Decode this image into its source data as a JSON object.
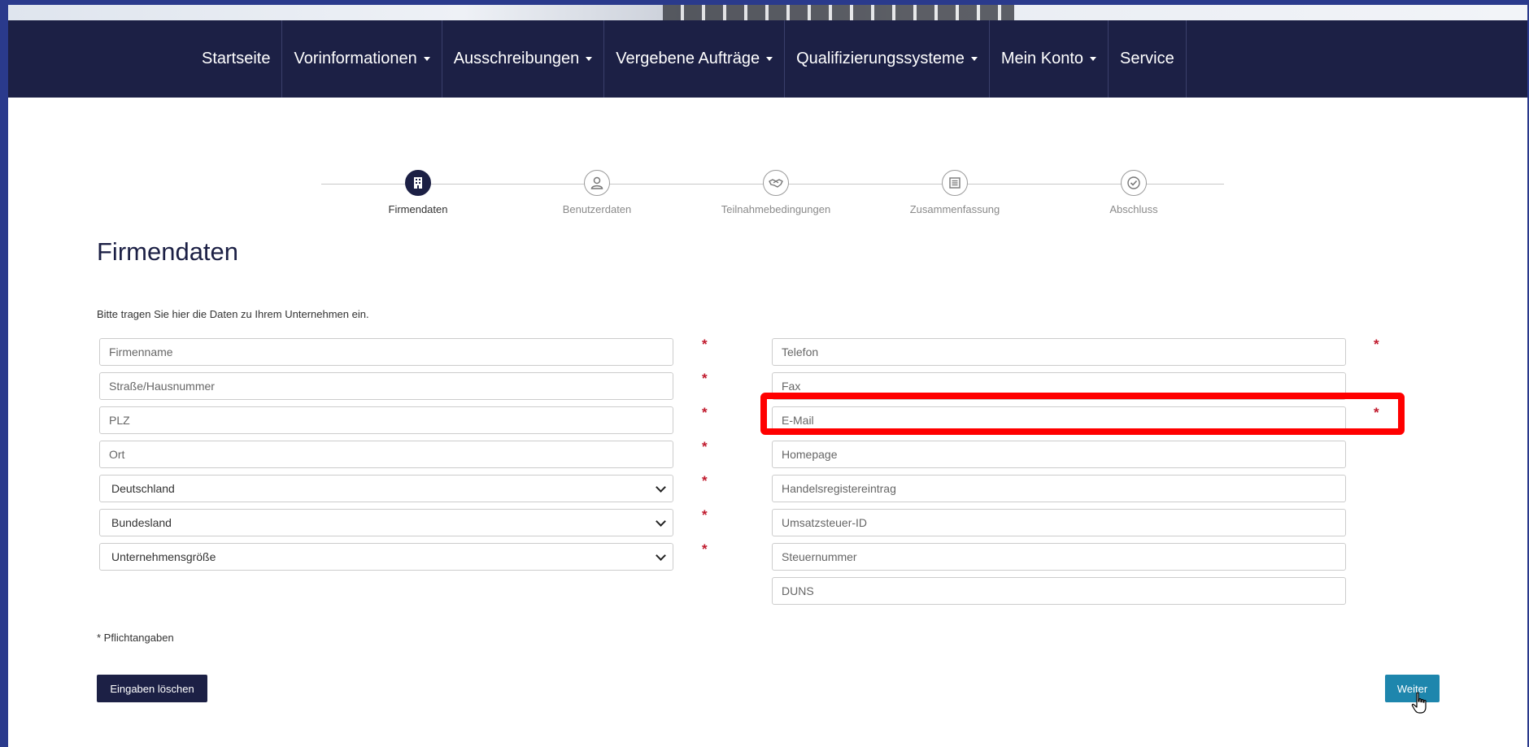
{
  "nav": {
    "items": [
      {
        "label": "Startseite",
        "dropdown": false
      },
      {
        "label": "Vorinformationen",
        "dropdown": true
      },
      {
        "label": "Ausschreibungen",
        "dropdown": true
      },
      {
        "label": "Vergebene Aufträge",
        "dropdown": true
      },
      {
        "label": "Qualifizierungssysteme",
        "dropdown": true
      },
      {
        "label": "Mein Konto",
        "dropdown": true
      },
      {
        "label": "Service",
        "dropdown": false
      }
    ]
  },
  "stepper": {
    "steps": [
      {
        "label": "Firmendaten",
        "icon": "building-icon",
        "active": true
      },
      {
        "label": "Benutzerdaten",
        "icon": "user-icon",
        "active": false
      },
      {
        "label": "Teilnahmebedingungen",
        "icon": "handshake-icon",
        "active": false
      },
      {
        "label": "Zusammenfassung",
        "icon": "list-icon",
        "active": false
      },
      {
        "label": "Abschluss",
        "icon": "check-circle-icon",
        "active": false
      }
    ]
  },
  "page": {
    "title": "Firmendaten",
    "intro": "Bitte tragen Sie hier die Daten zu Ihrem Unternehmen ein."
  },
  "form": {
    "left": [
      {
        "type": "input",
        "placeholder": "Firmenname",
        "required": true
      },
      {
        "type": "input",
        "placeholder": "Straße/Hausnummer",
        "required": true
      },
      {
        "type": "input",
        "placeholder": "PLZ",
        "required": true
      },
      {
        "type": "input",
        "placeholder": "Ort",
        "required": true
      },
      {
        "type": "select",
        "value": "Deutschland",
        "required": true
      },
      {
        "type": "select",
        "value": "Bundesland",
        "required": true
      },
      {
        "type": "select",
        "value": "Unternehmensgröße",
        "required": true
      }
    ],
    "right": [
      {
        "type": "input",
        "placeholder": "Telefon",
        "required": true
      },
      {
        "type": "input",
        "placeholder": "Fax",
        "required": false
      },
      {
        "type": "input",
        "placeholder": "E-Mail",
        "required": true
      },
      {
        "type": "input",
        "placeholder": "Homepage",
        "required": false
      },
      {
        "type": "input",
        "placeholder": "Handelsregistereintrag",
        "required": false
      },
      {
        "type": "input",
        "placeholder": "Umsatzsteuer-ID",
        "required": false
      },
      {
        "type": "input",
        "placeholder": "Steuernummer",
        "required": false
      },
      {
        "type": "input",
        "placeholder": "DUNS",
        "required": false
      }
    ],
    "required_marker": "*",
    "required_note": "* Pflichtangaben"
  },
  "buttons": {
    "clear": "Eingaben löschen",
    "next": "Weiter"
  },
  "colors": {
    "navbar": "#1c2045",
    "accent": "#1e86ad",
    "required": "#c0192c",
    "highlight": "#ff0000"
  }
}
